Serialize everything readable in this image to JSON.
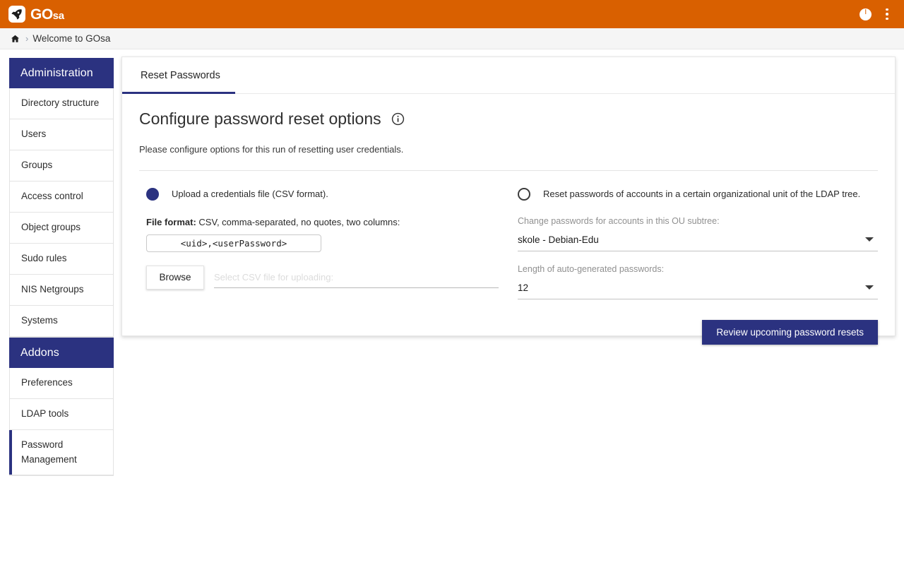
{
  "app": {
    "brand_go": "GO",
    "brand_sa": "sa",
    "logo_icon": "rocket-badge-icon",
    "accent_orange": "#d96000",
    "accent_navy": "#2b3280"
  },
  "topbar": {
    "avatar_icon": "account-circle-icon",
    "menu_icon": "more-vert-icon"
  },
  "breadcrumb": {
    "home_icon": "home-icon",
    "separator": "›",
    "current": "Welcome to GOsa"
  },
  "sidebar": {
    "groups": [
      {
        "title": "Administration",
        "items": [
          {
            "label": "Directory structure",
            "active": false
          },
          {
            "label": "Users",
            "active": false
          },
          {
            "label": "Groups",
            "active": false
          },
          {
            "label": "Access control",
            "active": false
          },
          {
            "label": "Object groups",
            "active": false
          },
          {
            "label": "Sudo rules",
            "active": false
          },
          {
            "label": "NIS Netgroups",
            "active": false
          },
          {
            "label": "Systems",
            "active": false
          }
        ]
      },
      {
        "title": "Addons",
        "items": [
          {
            "label": "Preferences",
            "active": false
          },
          {
            "label": "LDAP tools",
            "active": false
          },
          {
            "label": "Password Management",
            "active": true
          }
        ]
      }
    ]
  },
  "main": {
    "tabs": [
      {
        "label": "Reset Passwords",
        "selected": true
      }
    ],
    "heading": "Configure password reset options",
    "heading_info_icon": "info-circle-icon",
    "subtitle": "Please configure options for this run of resetting user credentials.",
    "option_csv": {
      "selected": true,
      "radio_icon": "radio-selected-icon",
      "label": "Upload a credentials file (CSV format).",
      "fileformat_label": "File format:",
      "fileformat_text": "CSV, comma-separated, no quotes, two columns:",
      "format_example": "<uid>,<userPassword>",
      "browse_label": "Browse",
      "file_placeholder": "Select CSV file for uploading:",
      "file_value": ""
    },
    "option_ou": {
      "selected": false,
      "radio_icon": "radio-unselected-icon",
      "label": "Reset passwords of accounts in a certain organizational unit of the LDAP tree.",
      "ou_label": "Change passwords for accounts in this OU subtree:",
      "ou_value": "skole - Debian-Edu",
      "length_label": "Length of auto-generated passwords:",
      "length_value": "12",
      "caret_icon": "chevron-down-icon"
    },
    "submit_label": "Review upcoming password resets"
  }
}
